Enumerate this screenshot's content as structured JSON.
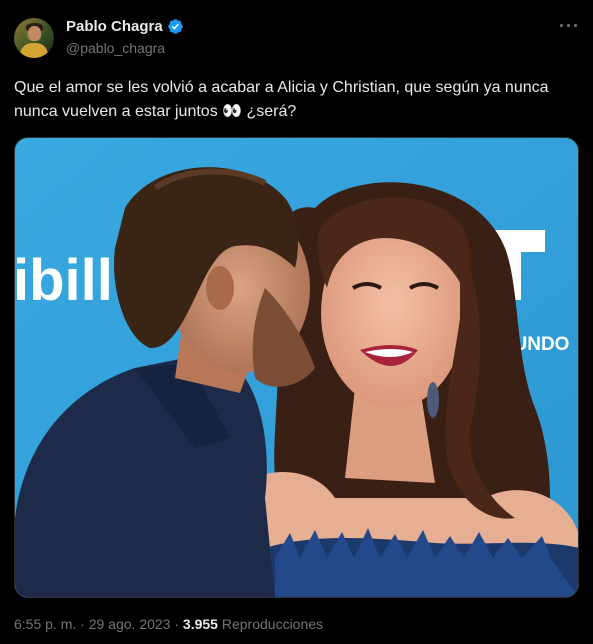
{
  "author": {
    "display_name": "Pablo Chagra",
    "handle": "@pablo_chagra",
    "verified_icon": "verified-badge-icon",
    "avatar_icon": "profile-avatar"
  },
  "more_icon": "more-options-icon",
  "tweet": {
    "text": "Que el amor se les volvió a acabar a Alicia y Christian, que según ya nunca nunca vuelven a estar juntos 👀 ¿será?"
  },
  "photo": {
    "backdrop_text_left": "ibill",
    "backdrop_text_right": "EMUNDO",
    "backdrop_color": "#35a4dc"
  },
  "meta": {
    "time": "6:55 p. m.",
    "separator": "·",
    "date": "29 ago. 2023",
    "views_count": "3.955",
    "views_label": "Reproducciones"
  },
  "colors": {
    "background": "#000000",
    "text_primary": "#e7e9ea",
    "text_secondary": "#71767b",
    "verified": "#1d9bf0"
  }
}
